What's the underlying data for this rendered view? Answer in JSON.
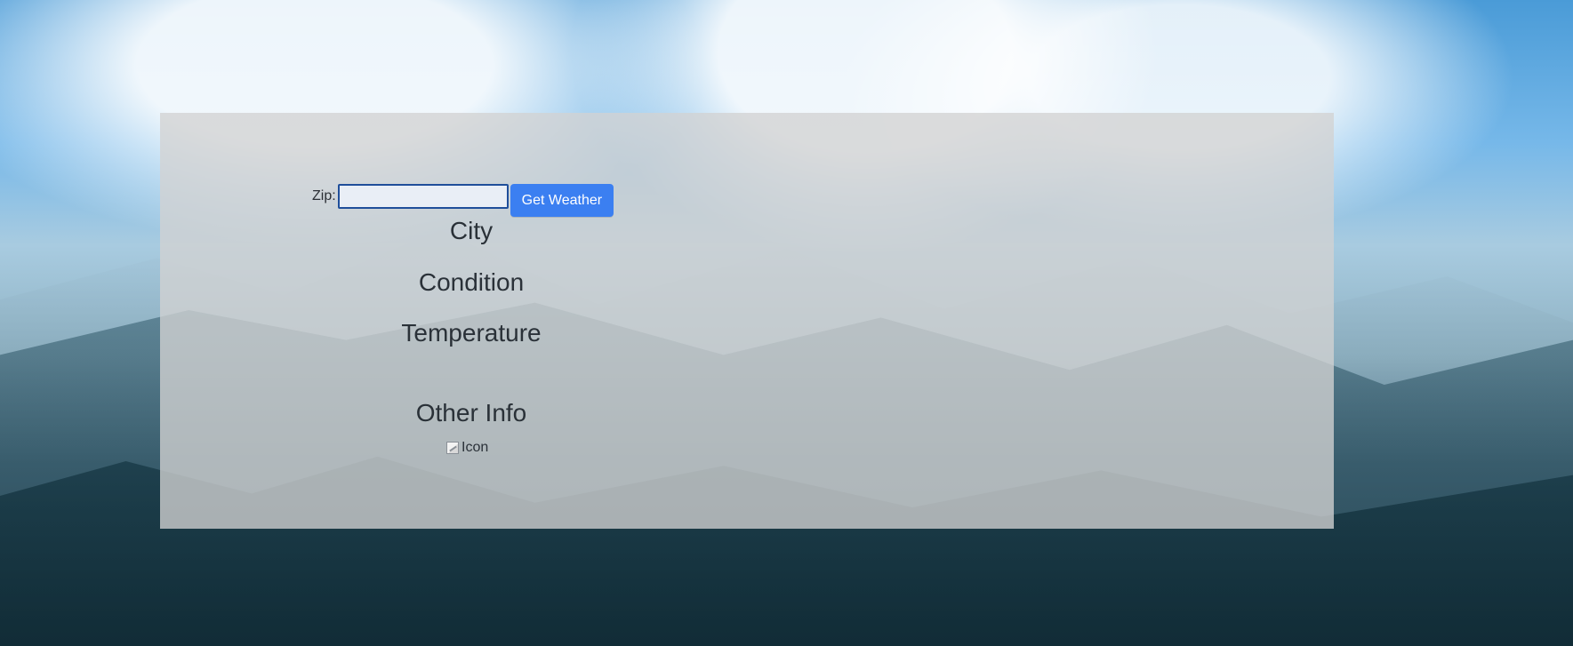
{
  "form": {
    "zip_label": "Zip:",
    "zip_value": "",
    "zip_placeholder": "",
    "button_label": "Get Weather"
  },
  "weather": {
    "city": "City",
    "condition": "Condition",
    "temperature": "Temperature",
    "other_info": "Other Info",
    "icon_alt": "Icon"
  },
  "colors": {
    "button": "#3b7ff1",
    "panel": "rgba(210,210,210,0.78)"
  },
  "icons": {
    "weather_icon": "broken-image-icon"
  }
}
